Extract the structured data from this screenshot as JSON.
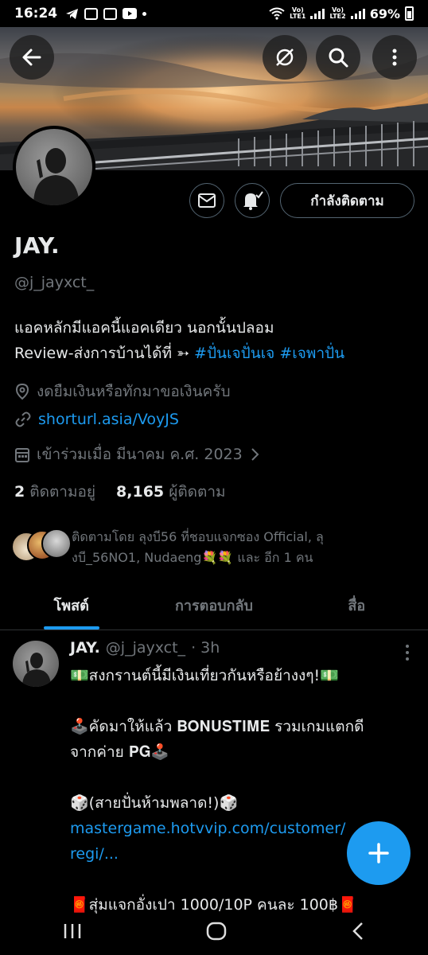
{
  "status_bar": {
    "time": "16:24",
    "lte1": "Vo)\nLTE1",
    "lte2": "Vo)\nLTE2",
    "battery": "69%"
  },
  "header_icons": [
    "back-arrow-icon",
    "no-translate-icon",
    "search-icon",
    "more-vertical-icon"
  ],
  "profile": {
    "name": "JAY.",
    "handle": "@j_jayxct_",
    "follow_button": "กำลังติดตาม",
    "bio_line1": "แอคหลักมีแอคนี้แอคเดียว นอกนั้นปลอม",
    "bio_line2_text": "Review-ส่งการบ้านได้ที่ ➳ ",
    "bio_hashtag1": "#ปั่นเจปั่นเจ",
    "bio_hashtag2": "#เจพาปั่น",
    "location": "งดยืมเงินหรือทักมาขอเงินครับ",
    "website": "shorturl.asia/VoyJS",
    "joined": "เข้าร่วมเมื่อ มีนาคม ค.ศ. 2023",
    "following_count": "2",
    "following_label": "ติดตามอยู่",
    "followers_count": "8,165",
    "followers_label": "ผู้ติดตาม",
    "followed_by_line1": "ติดตามโดย ลุงบี56 ที่ชอบแจกซอง Official, ลุ",
    "followed_by_line2": "งบี_56NO1, Nudaeng💐💐 และ อีก 1 คน"
  },
  "tabs": [
    {
      "label": "โพสต์",
      "active": true
    },
    {
      "label": "การตอบกลับ",
      "active": false
    },
    {
      "label": "สื่อ",
      "active": false
    }
  ],
  "post": {
    "name": "JAY.",
    "handle": "@j_jayxct_",
    "time": "· 3h",
    "line1": "💵สงกรานต์นี้มีเงินเที่ยวกันหรือย้างงๆ!💵",
    "line2": "🕹️คัดมาให้แล้ว 𝐁𝐎𝐍𝐔𝐒𝐓𝐈𝐌𝐄 รวมเกมแตกดี",
    "line3": "จากค่าย 𝐏𝐆🕹️",
    "line4": "🎲(สายปั่นห้ามพลาด!)🎲",
    "link1": "mastergame.hotvvip.com/customer/",
    "link2": "regi/...",
    "line5": "🧧สุ่มแจกอั่งเปา 1000/10P คนละ 100฿🧧"
  },
  "colors": {
    "accent": "#1d9bf0",
    "text_primary": "#e7e9ea",
    "text_secondary": "#71767b",
    "background": "#000000"
  }
}
